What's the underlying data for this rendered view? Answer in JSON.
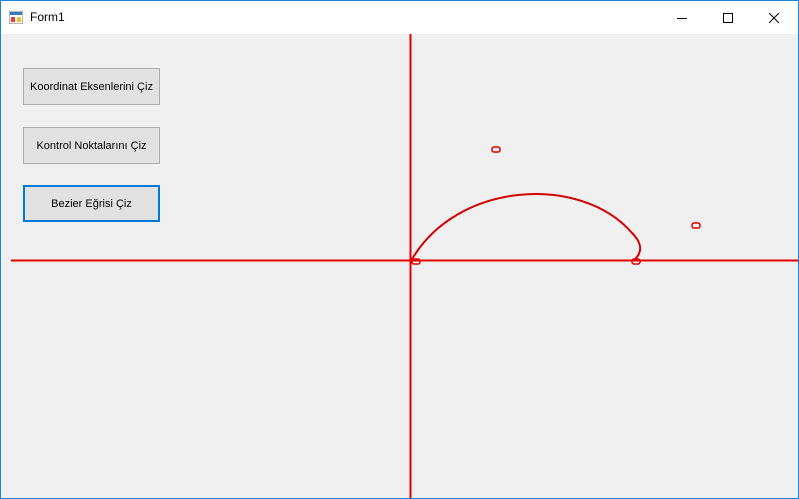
{
  "window": {
    "title": "Form1",
    "icon": "winforms-app-icon",
    "controls": [
      "minimize-icon",
      "maximize-icon",
      "close-icon"
    ]
  },
  "buttons": {
    "draw_axes": "Koordinat Eksenlerini Çiz",
    "draw_control_points": "Kontrol Noktalarını Çiz",
    "draw_bezier": "Bezier Eğrisi Çiz"
  },
  "drawing": {
    "axis_color": "#e00000",
    "curve_color": "#d40000",
    "marker_color": "#e00000"
  }
}
